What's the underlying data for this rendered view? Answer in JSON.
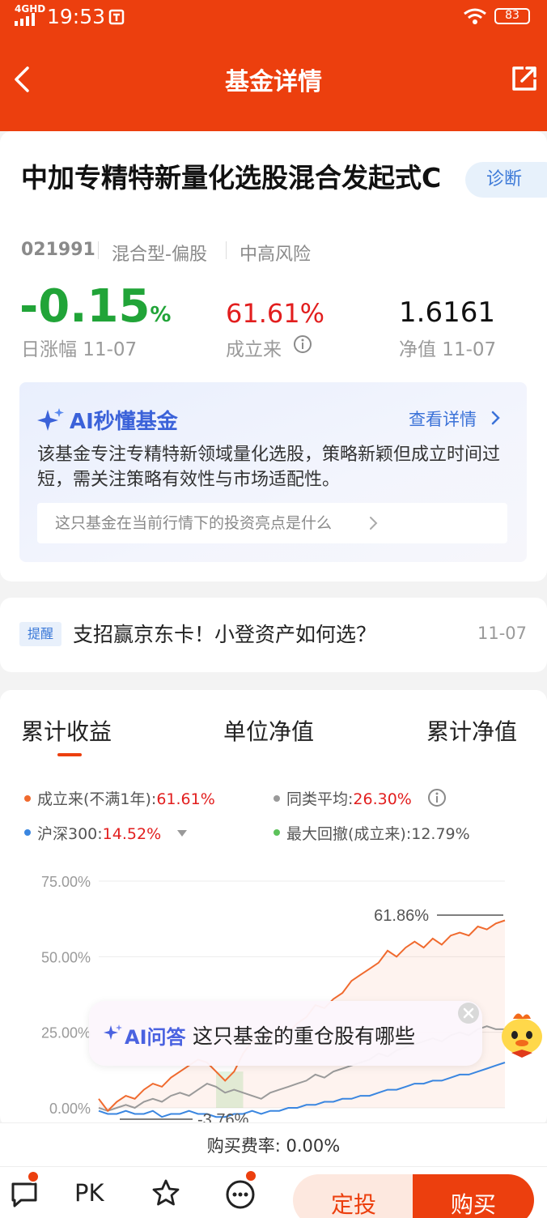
{
  "status_bar": {
    "network": "4GHD",
    "time": "19:53",
    "battery": "83"
  },
  "nav": {
    "title": "基金详情"
  },
  "fund": {
    "name": "中加专精特新量化选股混合发起式C",
    "code": "021991",
    "type": "混合型-偏股",
    "risk": "中高风险",
    "diagnose_label": "诊断"
  },
  "stats": {
    "daily_change": "-0.15",
    "daily_change_unit": "%",
    "daily_change_label": "日涨幅 11-07",
    "since_inception": "61.61%",
    "since_inception_label": "成立来",
    "nav_value": "1.6161",
    "nav_label": "净值 11-07"
  },
  "ai_summary": {
    "title": "AI秒懂基金",
    "more": "查看详情",
    "description": "该基金专注专精特新领域量化选股，策略新颖但成立时间过短，需关注策略有效性与市场适配性。",
    "question": "这只基金在当前行情下的投资亮点是什么"
  },
  "notice": {
    "tag": "提醒",
    "text": "支招赢京东卡！小登资产如何选？",
    "date": "11-07"
  },
  "tabs": [
    {
      "label": "累计收益"
    },
    {
      "label": "单位净值"
    },
    {
      "label": "累计净值"
    }
  ],
  "legend": {
    "since_inception_label": "成立来(不满1年):",
    "since_inception_value": "61.61%",
    "peer_avg_label": "同类平均:",
    "peer_avg_value": "26.30%",
    "hs300_label": "沪深300:",
    "hs300_value": "14.52%",
    "max_drawdown_label": "最大回撤(成立来):",
    "max_drawdown_value": "12.79%"
  },
  "chart_data": {
    "type": "line",
    "y_ticks": [
      "75.00%",
      "50.00%",
      "25.00%",
      "0.00%"
    ],
    "ylim": [
      0,
      75
    ],
    "peak_annotation": "61.86%",
    "trough_annotation": "-3.76%",
    "series": [
      {
        "color": "#f06a2e",
        "values": [
          3,
          -1,
          2,
          4,
          3,
          6,
          8,
          7,
          10,
          12,
          14,
          16,
          15,
          12,
          9,
          12,
          18,
          22,
          21,
          24,
          26,
          25,
          28,
          30,
          34,
          33,
          36,
          38,
          42,
          44,
          46,
          48,
          52,
          50,
          53,
          55,
          53,
          56,
          54,
          57,
          58,
          57,
          60,
          59,
          61,
          62
        ]
      },
      {
        "color": "#9a9a9a",
        "values": [
          0,
          -1,
          0,
          1,
          0,
          2,
          3,
          2,
          4,
          5,
          4,
          6,
          8,
          7,
          5,
          6,
          5,
          4,
          3,
          5,
          6,
          7,
          8,
          9,
          11,
          10,
          12,
          13,
          14,
          15,
          16,
          18,
          17,
          19,
          20,
          21,
          22,
          23,
          22,
          24,
          25,
          24,
          26,
          27,
          26,
          26
        ]
      },
      {
        "color": "#3a86e0",
        "values": [
          -1,
          -2,
          -2,
          -1,
          -2,
          -2,
          -1,
          -3,
          -2,
          -2,
          -1,
          -2,
          -2,
          -3,
          -3,
          -2,
          -2,
          -1,
          -2,
          -1,
          -1,
          0,
          0,
          1,
          1,
          2,
          2,
          3,
          3,
          4,
          4,
          5,
          6,
          6,
          7,
          8,
          8,
          9,
          9,
          10,
          11,
          11,
          12,
          13,
          14,
          15
        ]
      }
    ]
  },
  "ai_float": {
    "label": "AI问答",
    "text": "这只基金的重仓股有哪些"
  },
  "fee": {
    "text": "购买费率: 0.00%"
  },
  "bottom": {
    "pk_label": "PK",
    "dingtou_label": "定投",
    "buy_label": "购买"
  }
}
